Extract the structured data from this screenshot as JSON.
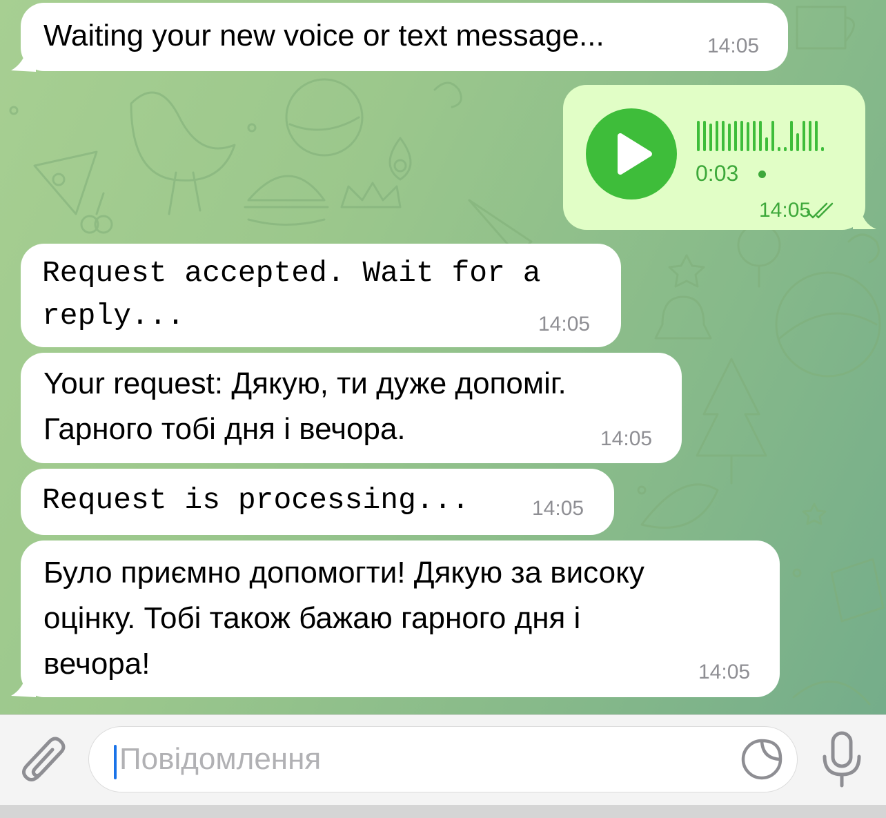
{
  "messages": [
    {
      "text": "Waiting your new voice or text message...",
      "time": "14:05"
    },
    {
      "voice_duration": "0:03",
      "time": "14:05"
    },
    {
      "line1": "Request accepted. Wait for a",
      "line2": "reply...",
      "time": "14:05"
    },
    {
      "line1": "Your request: Дякую, ти дуже допоміг.",
      "line2": "Гарного тобі дня і вечора.",
      "time": "14:05"
    },
    {
      "text": "Request is processing...",
      "time": "14:05"
    },
    {
      "line1": "Було приємно допомогти! Дякую за високу",
      "line2": "оцінку. Тобі також бажаю гарного дня і",
      "line3": "вечора!",
      "time": "14:05"
    }
  ],
  "input": {
    "placeholder": "Повідомлення"
  },
  "icons": {
    "attach": "paperclip-icon",
    "sticker": "sticker-icon",
    "mic": "microphone-icon",
    "play": "play-icon",
    "read_receipt": "double-check-icon"
  },
  "colors": {
    "outgoing_bubble": "#e1fec6",
    "play_button": "#3ebd3a",
    "accent_green": "#3da83a",
    "cursor": "#1a73e8"
  }
}
